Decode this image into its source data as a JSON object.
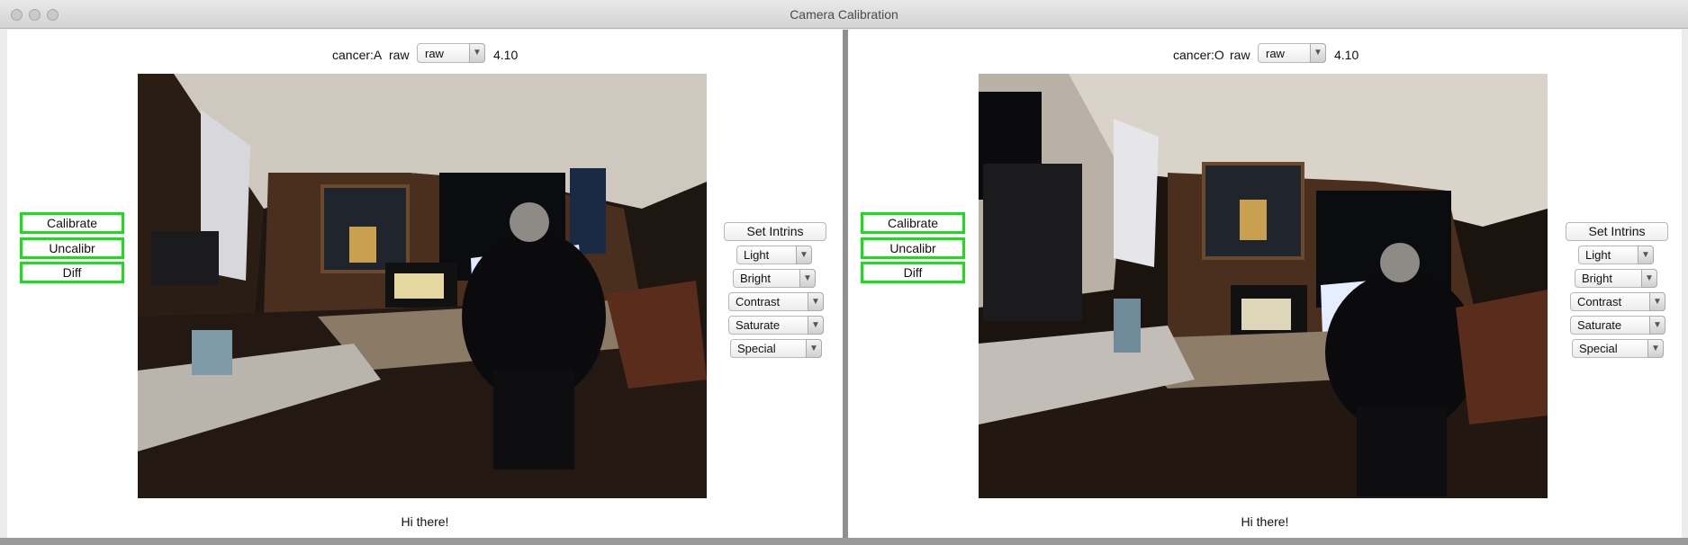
{
  "window": {
    "title": "Camera Calibration"
  },
  "panes": [
    {
      "camera": "cancer:A",
      "raw_label": "raw",
      "mode_select": "raw",
      "version": "4.10",
      "left_buttons": [
        "Calibrate",
        "Uncalibr",
        "Diff"
      ],
      "set_intrins": "Set Intrins",
      "dropdowns": [
        "Light",
        "Bright",
        "Contrast",
        "Saturate",
        "Special"
      ],
      "caption": "Hi there!"
    },
    {
      "camera": "cancer:O",
      "raw_label": "raw",
      "mode_select": "raw",
      "version": "4.10",
      "left_buttons": [
        "Calibrate",
        "Uncalibr",
        "Diff"
      ],
      "set_intrins": "Set Intrins",
      "dropdowns": [
        "Light",
        "Bright",
        "Contrast",
        "Saturate",
        "Special"
      ],
      "caption": "Hi there!"
    }
  ],
  "colors": {
    "accent_border": "#16e016",
    "window_bg": "#ececec",
    "divider": "#8f8f8f"
  },
  "icons": [
    "close-button-icon",
    "minimize-button-icon",
    "zoom-button-icon",
    "chevron-down-icon"
  ]
}
